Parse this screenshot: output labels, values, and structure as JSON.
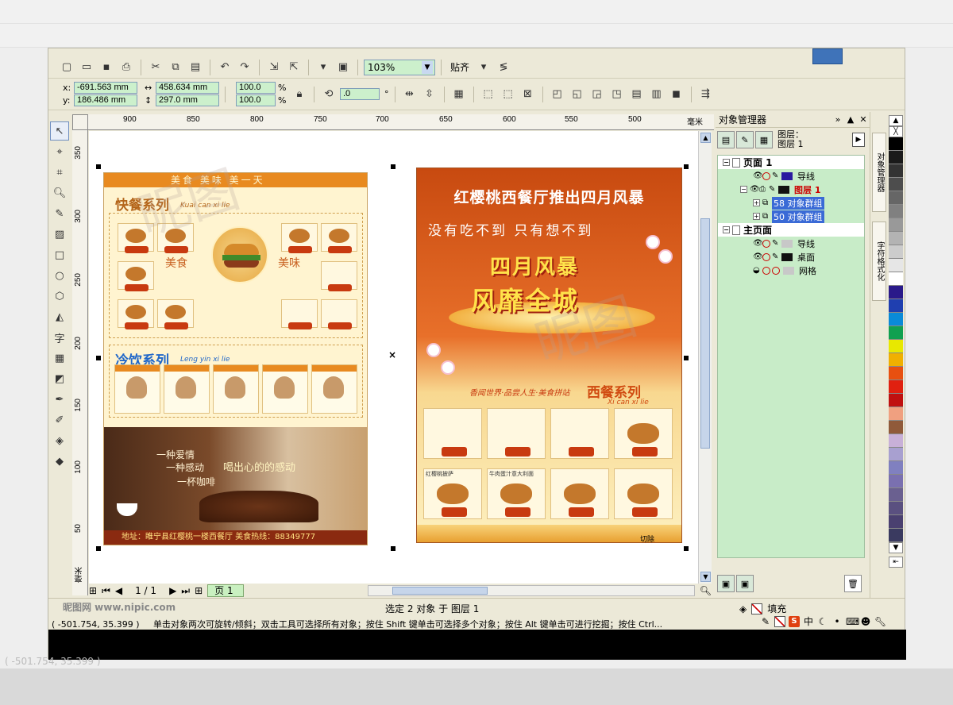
{
  "window": {
    "accent_color": "#3f73b9"
  },
  "toolbar": {
    "icons": [
      "new-icon",
      "open-icon",
      "save-icon",
      "print-icon",
      "cut-icon",
      "copy-icon",
      "paste-icon",
      "undo-icon",
      "redo-icon",
      "import-icon",
      "export-icon",
      "app-launcher-icon",
      "welcome-icon"
    ],
    "zoom_value": "103%",
    "snap_label": "贴齐"
  },
  "property_bar": {
    "x_label": "x:",
    "x_value": "-691.563 mm",
    "y_label": "y:",
    "y_value": "186.486 mm",
    "width_value": "458.634 mm",
    "height_value": "297.0 mm",
    "scale_x": "100.0",
    "scale_y": "100.0",
    "percent": "%",
    "rotation": ".0",
    "degree": "°"
  },
  "rulers": {
    "h_ticks": [
      "900",
      "850",
      "800",
      "750",
      "700",
      "650",
      "600",
      "550",
      "500",
      "毫米"
    ],
    "v_ticks": [
      "350",
      "300",
      "250",
      "200",
      "150",
      "100",
      "50",
      "毫米"
    ]
  },
  "page1": {
    "top_banner": "美食 美味 美一天",
    "fast_title": "快餐系列",
    "fast_pinyin": "Kuai can xi lie",
    "word_left": "美食",
    "word_right": "美味",
    "drink_title": "冷饮系列",
    "drink_pinyin": "Leng yin xi lie",
    "coffee_line1": "一种爱情",
    "coffee_line2": "一种感动",
    "coffee_line3": "一杯咖啡",
    "coffee_slogan": "喝出心的的感动",
    "address": "地址：睢宁县红樱桃一楼西餐厅 美食热线：88349777"
  },
  "page2": {
    "headline": "红樱桃西餐厅推出四月风暴",
    "subline": "没有吃不到 只有想不到",
    "big1": "四月风暴",
    "big2": "风靡全城",
    "slogan": "香闻世界·品尝人生·美食拼站",
    "sect_title": "西餐系列",
    "sect_pinyin": "Xi can xi lie",
    "item_labels": [
      "红樱桃披萨",
      "牛肉蛋汁意大利面"
    ],
    "mark": "切除"
  },
  "pagebar": {
    "page_count": "1 / 1",
    "page_tab": "页 1"
  },
  "object_manager": {
    "title": "对象管理器",
    "layer_label": "图层：",
    "layer_name": "图层 1",
    "page1": "页面 1",
    "guides": "导线",
    "layer1": "图层 1",
    "group1": "58 对象群组",
    "group2": "50 对象群组",
    "master": "主页面",
    "master_guides": "导线",
    "desktop": "桌面",
    "grid": "网格"
  },
  "side_tabs": {
    "tab1": "对象管理器",
    "tab2": "字符格式化"
  },
  "palette_colors": [
    "#000000",
    "#1a1a1a",
    "#333333",
    "#4d4d4d",
    "#666666",
    "#808080",
    "#999999",
    "#b3b3b3",
    "#cccccc",
    "#e6e6e6",
    "#ffffff",
    "#2a1a8a",
    "#1f3fb0",
    "#0a8ad8",
    "#10a050",
    "#e8e800",
    "#f0b000",
    "#e85010",
    "#e02010",
    "#c01010",
    "#f0a080",
    "#905a3a",
    "#c8b0d8",
    "#a8a0d0",
    "#8080c0",
    "#7a70b0",
    "#6a6090",
    "#5a5080",
    "#4a4070",
    "#3a3a60"
  ],
  "status": {
    "logo": "昵图网 www.nipic.com",
    "selection": "选定 2 对象 于 图层 1",
    "fill_label": "填充",
    "coords": "( -501.754, 35.399 )",
    "hint": "单击对象两次可旋转/倾斜；双击工具可选择所有对象；按住 Shift 键单击可选择多个对象；按住 Alt 键单击可进行挖掘；按住 Ctrl..."
  }
}
